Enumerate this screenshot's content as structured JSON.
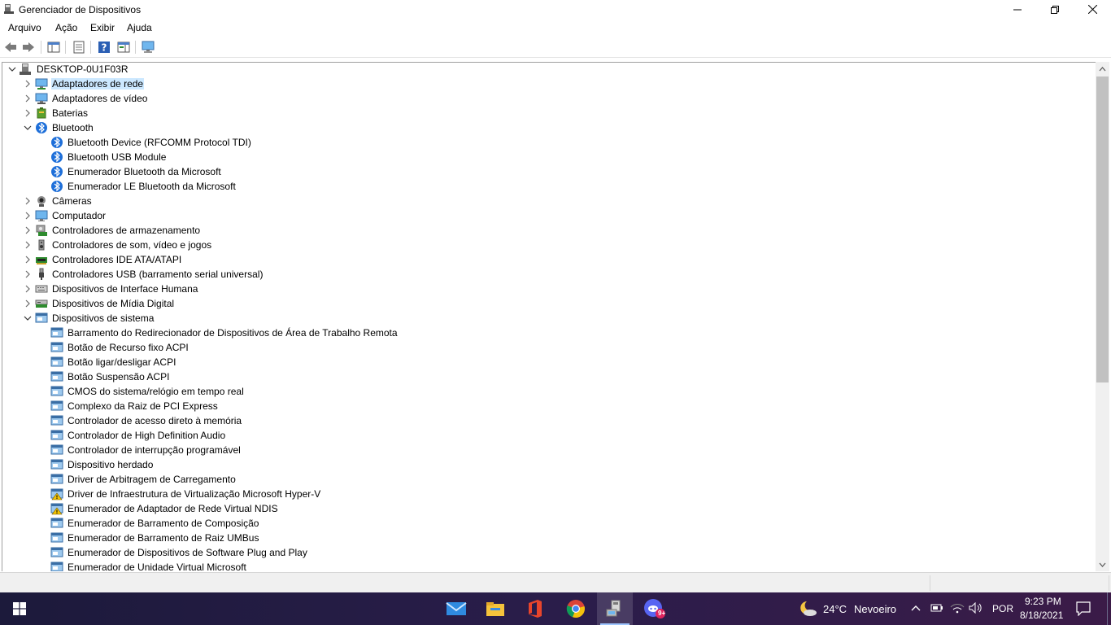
{
  "window": {
    "title": "Gerenciador de Dispositivos"
  },
  "menu": [
    "Arquivo",
    "Ação",
    "Exibir",
    "Ajuda"
  ],
  "tree": [
    {
      "label": "DESKTOP-0U1F03R",
      "level": 0,
      "expander": "expanded",
      "icon": "computer-icon"
    },
    {
      "label": "Adaptadores de rede",
      "level": 1,
      "expander": "collapsed",
      "icon": "network-adapter-icon",
      "selected": true
    },
    {
      "label": "Adaptadores de vídeo",
      "level": 1,
      "expander": "collapsed",
      "icon": "display-adapter-icon"
    },
    {
      "label": "Baterias",
      "level": 1,
      "expander": "collapsed",
      "icon": "battery-icon"
    },
    {
      "label": "Bluetooth",
      "level": 1,
      "expander": "expanded",
      "icon": "bluetooth-icon"
    },
    {
      "label": "Bluetooth Device (RFCOMM Protocol TDI)",
      "level": 2,
      "expander": "none",
      "icon": "bluetooth-icon"
    },
    {
      "label": "Bluetooth USB Module",
      "level": 2,
      "expander": "none",
      "icon": "bluetooth-icon"
    },
    {
      "label": "Enumerador Bluetooth da Microsoft",
      "level": 2,
      "expander": "none",
      "icon": "bluetooth-icon"
    },
    {
      "label": "Enumerador LE Bluetooth da Microsoft",
      "level": 2,
      "expander": "none",
      "icon": "bluetooth-icon"
    },
    {
      "label": "Câmeras",
      "level": 1,
      "expander": "collapsed",
      "icon": "camera-icon"
    },
    {
      "label": "Computador",
      "level": 1,
      "expander": "collapsed",
      "icon": "monitor-icon"
    },
    {
      "label": "Controladores de armazenamento",
      "level": 1,
      "expander": "collapsed",
      "icon": "storage-controller-icon"
    },
    {
      "label": "Controladores de som, vídeo e jogos",
      "level": 1,
      "expander": "collapsed",
      "icon": "speaker-icon"
    },
    {
      "label": "Controladores IDE ATA/ATAPI",
      "level": 1,
      "expander": "collapsed",
      "icon": "ide-controller-icon"
    },
    {
      "label": "Controladores USB (barramento serial universal)",
      "level": 1,
      "expander": "collapsed",
      "icon": "usb-icon"
    },
    {
      "label": "Dispositivos de Interface Humana",
      "level": 1,
      "expander": "collapsed",
      "icon": "hid-icon"
    },
    {
      "label": "Dispositivos de Mídia Digital",
      "level": 1,
      "expander": "collapsed",
      "icon": "digital-media-icon"
    },
    {
      "label": "Dispositivos de sistema",
      "level": 1,
      "expander": "expanded",
      "icon": "system-device-icon"
    },
    {
      "label": "Barramento do Redirecionador de Dispositivos de Área de Trabalho Remota",
      "level": 2,
      "expander": "none",
      "icon": "system-device-icon"
    },
    {
      "label": "Botão de Recurso fixo ACPI",
      "level": 2,
      "expander": "none",
      "icon": "system-device-icon"
    },
    {
      "label": "Botão ligar/desligar ACPI",
      "level": 2,
      "expander": "none",
      "icon": "system-device-icon"
    },
    {
      "label": "Botão Suspensão ACPI",
      "level": 2,
      "expander": "none",
      "icon": "system-device-icon"
    },
    {
      "label": "CMOS do sistema/relógio em tempo real",
      "level": 2,
      "expander": "none",
      "icon": "system-device-icon"
    },
    {
      "label": "Complexo da Raiz de PCI Express",
      "level": 2,
      "expander": "none",
      "icon": "system-device-icon"
    },
    {
      "label": "Controlador de acesso direto à memória",
      "level": 2,
      "expander": "none",
      "icon": "system-device-icon"
    },
    {
      "label": "Controlador de High Definition Audio",
      "level": 2,
      "expander": "none",
      "icon": "system-device-icon"
    },
    {
      "label": "Controlador de interrupção programável",
      "level": 2,
      "expander": "none",
      "icon": "system-device-icon"
    },
    {
      "label": "Dispositivo herdado",
      "level": 2,
      "expander": "none",
      "icon": "system-device-icon"
    },
    {
      "label": "Driver de Arbitragem de Carregamento",
      "level": 2,
      "expander": "none",
      "icon": "system-device-icon"
    },
    {
      "label": "Driver de Infraestrutura de Virtualização Microsoft Hyper-V",
      "level": 2,
      "expander": "none",
      "icon": "system-device-warning-icon"
    },
    {
      "label": "Enumerador de Adaptador de Rede Virtual NDIS",
      "level": 2,
      "expander": "none",
      "icon": "system-device-warning-icon"
    },
    {
      "label": "Enumerador de Barramento de Composição",
      "level": 2,
      "expander": "none",
      "icon": "system-device-icon"
    },
    {
      "label": "Enumerador de Barramento de Raiz UMBus",
      "level": 2,
      "expander": "none",
      "icon": "system-device-icon"
    },
    {
      "label": "Enumerador de Dispositivos de Software Plug and Play",
      "level": 2,
      "expander": "none",
      "icon": "system-device-icon"
    },
    {
      "label": "Enumerador de Unidade Virtual Microsoft",
      "level": 2,
      "expander": "none",
      "icon": "system-device-icon"
    }
  ],
  "taskbar": {
    "apps": [
      "mail-icon",
      "file-explorer-icon",
      "office-icon",
      "chrome-icon",
      "device-manager-icon",
      "discord-icon"
    ],
    "discord_badge": "9+",
    "weather_temp": "24°C",
    "weather_desc": "Nevoeiro",
    "language": "POR",
    "time": "9:23 PM",
    "date": "8/18/2021"
  },
  "colors": {
    "selection": "#cce8ff",
    "taskbar": "#2a1d4a",
    "accent": "#0078d7"
  }
}
